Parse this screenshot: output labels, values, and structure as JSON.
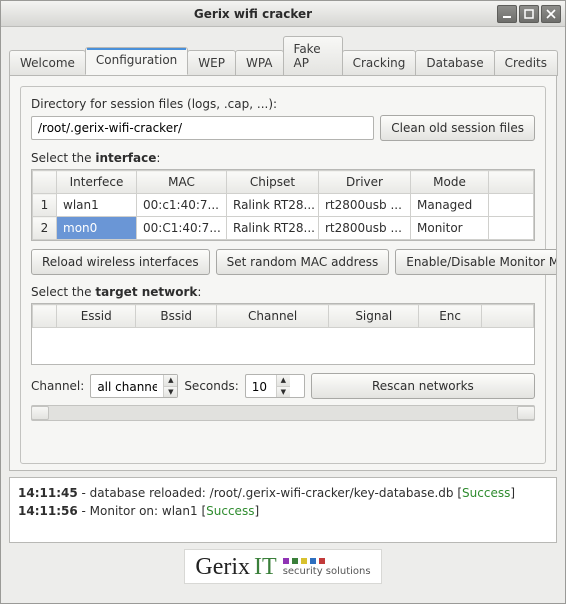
{
  "window": {
    "title": "Gerix wifi cracker"
  },
  "tabs": [
    "Welcome",
    "Configuration",
    "WEP",
    "WPA",
    "Fake AP",
    "Cracking",
    "Database",
    "Credits"
  ],
  "activeTab": 1,
  "session": {
    "label": "Directory for session files (logs, .cap, ...):",
    "path": "/root/.gerix-wifi-cracker/",
    "clean_btn": "Clean old session files"
  },
  "iface": {
    "label_pre": "Select the ",
    "label_bold": "interface",
    "label_post": ":",
    "cols": [
      "Interfece",
      "MAC",
      "Chipset",
      "Driver",
      "Mode"
    ],
    "rows": [
      {
        "n": "1",
        "name": "wlan1",
        "mac": "00:c1:40:7...",
        "chipset": "Ralink RT28...",
        "driver": "rt2800usb ...",
        "mode": "Managed"
      },
      {
        "n": "2",
        "name": "mon0",
        "mac": "00:C1:40:7...",
        "chipset": "Ralink RT28...",
        "driver": "rt2800usb ...",
        "mode": "Monitor"
      }
    ],
    "reload_btn": "Reload wireless interfaces",
    "macrand_btn": "Set random MAC address",
    "monmode_btn": "Enable/Disable Monitor Mode"
  },
  "net": {
    "label_pre": "Select the ",
    "label_bold": "target network",
    "label_post": ":",
    "cols": [
      "Essid",
      "Bssid",
      "Channel",
      "Signal",
      "Enc"
    ]
  },
  "scan": {
    "channel_label": "Channel:",
    "channel_value": "all channels",
    "seconds_label": "Seconds:",
    "seconds_value": "10",
    "rescan_btn": "Rescan networks"
  },
  "log": [
    {
      "ts": "14:11:45",
      "msg": " - database reloaded: /root/.gerix-wifi-cracker/key-database.db ",
      "status": "Success"
    },
    {
      "ts": "14:11:56",
      "msg": " - Monitor on: wlan1 ",
      "status": "Success"
    }
  ],
  "brand": {
    "name": "Gerix",
    "it": "IT",
    "tag": "security solutions",
    "dot_colors": [
      "#9033b5",
      "#3a7f3a",
      "#d8c12e",
      "#2e6fbf",
      "#c23a3a"
    ]
  }
}
